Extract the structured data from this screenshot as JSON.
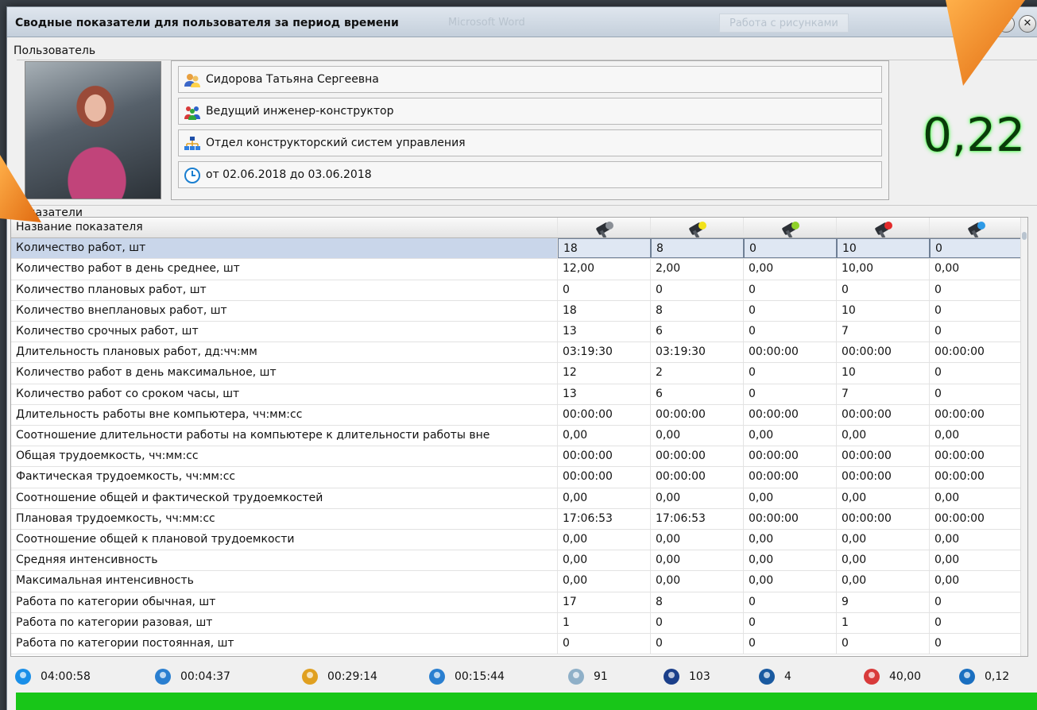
{
  "window": {
    "title": "Сводные показатели для пользователя за период времени",
    "ghost_word": "Microsoft Word",
    "ghost_tab": "Работа с рисунками",
    "min_glyph": "–",
    "close_glyph": "✕"
  },
  "user_section": {
    "label": "Пользователь",
    "name": "Сидорова Татьяна Сергеевна",
    "position": "Ведущий инженер-конструктор",
    "department": "Отдел конструкторский систем управления",
    "period": "от 02.06.2018 до 03.06.2018",
    "icons": [
      "user-icon",
      "team-icon",
      "org-chart-icon",
      "clock-icon"
    ]
  },
  "score": "0,22",
  "indicators_section": {
    "label": "Показатели",
    "name_header": "Название показателя",
    "column_icons": [
      "hammer-gray-icon",
      "hammer-yellow-icon",
      "hammer-green-icon",
      "hammer-red-icon",
      "hammer-blue-icon"
    ],
    "column_colors": [
      "#8a8f96",
      "#f2e21a",
      "#8fd12a",
      "#e32a2a",
      "#2e9ae6"
    ],
    "rows": [
      {
        "name": "Количество работ, шт",
        "v": [
          "18",
          "8",
          "0",
          "10",
          "0"
        ]
      },
      {
        "name": "Количество работ в день среднее, шт",
        "v": [
          "12,00",
          "2,00",
          "0,00",
          "10,00",
          "0,00"
        ]
      },
      {
        "name": "Количество плановых работ, шт",
        "v": [
          "0",
          "0",
          "0",
          "0",
          "0"
        ]
      },
      {
        "name": "Количество внеплановых работ, шт",
        "v": [
          "18",
          "8",
          "0",
          "10",
          "0"
        ]
      },
      {
        "name": "Количество срочных работ, шт",
        "v": [
          "13",
          "6",
          "0",
          "7",
          "0"
        ]
      },
      {
        "name": "Длительность плановых работ, дд:чч:мм",
        "v": [
          "03:19:30",
          "03:19:30",
          "00:00:00",
          "00:00:00",
          "00:00:00"
        ]
      },
      {
        "name": "Количество работ в день максимальное, шт",
        "v": [
          "12",
          "2",
          "0",
          "10",
          "0"
        ]
      },
      {
        "name": "Количество работ со сроком часы, шт",
        "v": [
          "13",
          "6",
          "0",
          "7",
          "0"
        ]
      },
      {
        "name": "Длительность работы вне компьютера, чч:мм:сс",
        "v": [
          "00:00:00",
          "00:00:00",
          "00:00:00",
          "00:00:00",
          "00:00:00"
        ]
      },
      {
        "name": "Соотношение длительности работы на компьютере к длительности работы вне",
        "v": [
          "0,00",
          "0,00",
          "0,00",
          "0,00",
          "0,00"
        ]
      },
      {
        "name": "Общая трудоемкость, чч:мм:сс",
        "v": [
          "00:00:00",
          "00:00:00",
          "00:00:00",
          "00:00:00",
          "00:00:00"
        ]
      },
      {
        "name": "Фактическая трудоемкость, чч:мм:сс",
        "v": [
          "00:00:00",
          "00:00:00",
          "00:00:00",
          "00:00:00",
          "00:00:00"
        ]
      },
      {
        "name": "Соотношение общей и фактической трудоемкостей",
        "v": [
          "0,00",
          "0,00",
          "0,00",
          "0,00",
          "0,00"
        ]
      },
      {
        "name": "Плановая трудоемкость, чч:мм:сс",
        "v": [
          "17:06:53",
          "17:06:53",
          "00:00:00",
          "00:00:00",
          "00:00:00"
        ]
      },
      {
        "name": "Соотношение общей к плановой трудоемкости",
        "v": [
          "0,00",
          "0,00",
          "0,00",
          "0,00",
          "0,00"
        ]
      },
      {
        "name": "Средняя интенсивность",
        "v": [
          "0,00",
          "0,00",
          "0,00",
          "0,00",
          "0,00"
        ]
      },
      {
        "name": "Максимальная интенсивность",
        "v": [
          "0,00",
          "0,00",
          "0,00",
          "0,00",
          "0,00"
        ]
      },
      {
        "name": "Работа по категории обычная, шт",
        "v": [
          "17",
          "8",
          "0",
          "9",
          "0"
        ]
      },
      {
        "name": "Работа по категории разовая, шт",
        "v": [
          "1",
          "0",
          "0",
          "1",
          "0"
        ]
      },
      {
        "name": "Работа по категории постоянная, шт",
        "v": [
          "0",
          "0",
          "0",
          "0",
          "0"
        ]
      }
    ],
    "selected_row": 0
  },
  "status_bar": [
    {
      "icon": "head-icon",
      "value": "04:00:58"
    },
    {
      "icon": "people-network-icon",
      "value": "00:04:37"
    },
    {
      "icon": "pen-tool-icon",
      "value": "00:29:14"
    },
    {
      "icon": "hand-network-icon",
      "value": "00:15:44"
    },
    {
      "icon": "mouse-icon",
      "value": "91"
    },
    {
      "icon": "keyboard-icon",
      "value": "103"
    },
    {
      "icon": "monitor-icon",
      "value": "4"
    },
    {
      "icon": "max-gauge-icon",
      "value": "40,00",
      "badge": "max"
    },
    {
      "icon": "dial-icon",
      "value": "0,12"
    }
  ],
  "accent": {
    "score_glow": "#44ff44",
    "greenbar": "#18c618",
    "arrow": "#f08a1c"
  }
}
